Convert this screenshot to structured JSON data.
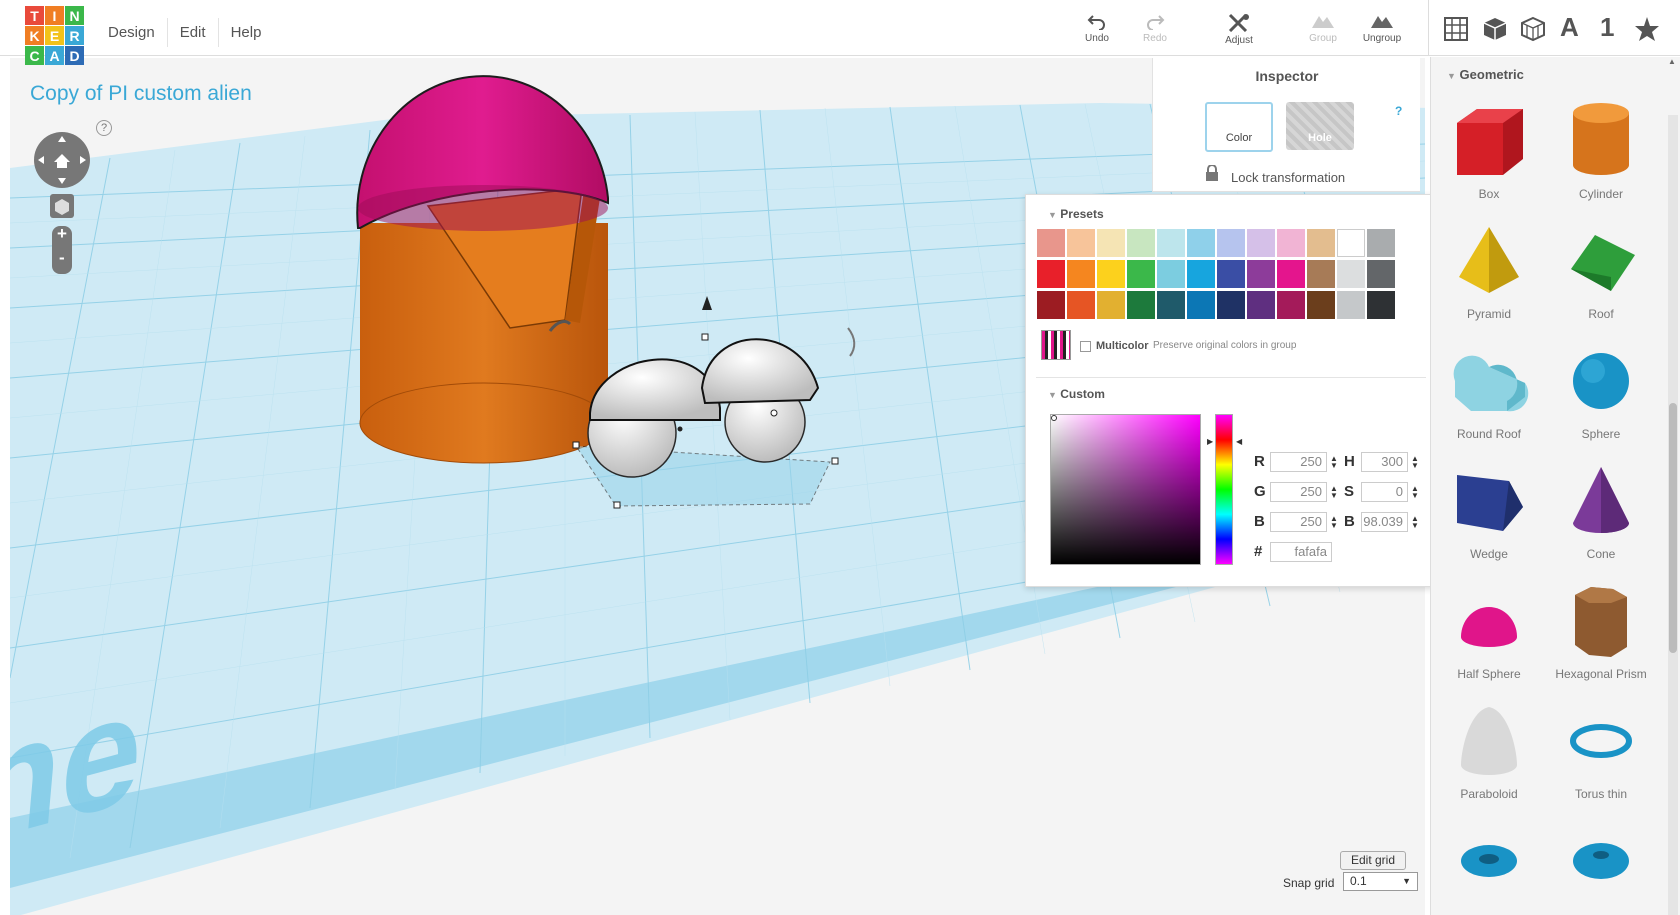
{
  "app": {
    "logo": [
      "T",
      "I",
      "N",
      "K",
      "E",
      "R",
      "C",
      "A",
      "D"
    ],
    "logo_colors": [
      "#e94a3b",
      "#f07e23",
      "#3bb84a",
      "#f07e23",
      "#f2c21a",
      "#3aa8d6",
      "#3bb84a",
      "#3aa8d6",
      "#2d6bb5"
    ]
  },
  "menu": {
    "items": [
      "Design",
      "Edit",
      "Help"
    ]
  },
  "toolbar": {
    "undo": "Undo",
    "redo": "Redo",
    "adjust": "Adjust",
    "group": "Group",
    "ungroup": "Ungroup"
  },
  "right_toolbar": {
    "text_tool": "A",
    "number_tool": "1"
  },
  "document": {
    "title": "Copy of PI custom alien"
  },
  "viewcontrols": {
    "help": "?",
    "zoom_in": "+",
    "zoom_out": "-"
  },
  "workplane": {
    "watermark": "plane",
    "edit_grid": "Edit grid",
    "snap_label": "Snap grid",
    "snap_value": "0.1"
  },
  "inspector": {
    "title": "Inspector",
    "color_label": "Color",
    "hole_label": "Hole",
    "help": "?",
    "lock_label": "Lock transformation"
  },
  "colorpicker": {
    "presets_label": "Presets",
    "preset_rows": [
      [
        "#e8968c",
        "#f7c49a",
        "#f5e4b4",
        "#c8e6c0",
        "#bde5ec",
        "#8fd0ea",
        "#b6c4ee",
        "#d5c0e8",
        "#f1b4d4",
        "#e3bd8f",
        "#ffffff",
        "#a9acae"
      ],
      [
        "#e8202a",
        "#f5861f",
        "#fcd11d",
        "#3bb84a",
        "#7ccde0",
        "#17a5de",
        "#3a4ea5",
        "#8d3c9a",
        "#e4158d",
        "#a77b57",
        "#dcdedf",
        "#636669"
      ],
      [
        "#9c1c22",
        "#e65524",
        "#e2b030",
        "#1d7a3c",
        "#1f5a6a",
        "#0c77b5",
        "#1f3265",
        "#5f2f80",
        "#a41b5a",
        "#6b3e1c",
        "#c5c8ca",
        "#2e3134"
      ]
    ],
    "multicolor_label": "Multicolor",
    "multicolor_hint": "Preserve original colors in group",
    "custom_label": "Custom",
    "r_label": "R",
    "r": "250",
    "g_label": "G",
    "g": "250",
    "b_label": "B",
    "b": "250",
    "h_label": "H",
    "h": "300",
    "s_label": "S",
    "s": "0",
    "v_label": "B",
    "v": "98.039",
    "hex_label": "#",
    "hex": "fafafa"
  },
  "shapes_panel": {
    "category": "Geometric",
    "shapes": [
      "Box",
      "Cylinder",
      "Pyramid",
      "Roof",
      "Round Roof",
      "Sphere",
      "Wedge",
      "Cone",
      "Half Sphere",
      "Hexagonal Prism",
      "Paraboloid",
      "Torus thin"
    ]
  }
}
